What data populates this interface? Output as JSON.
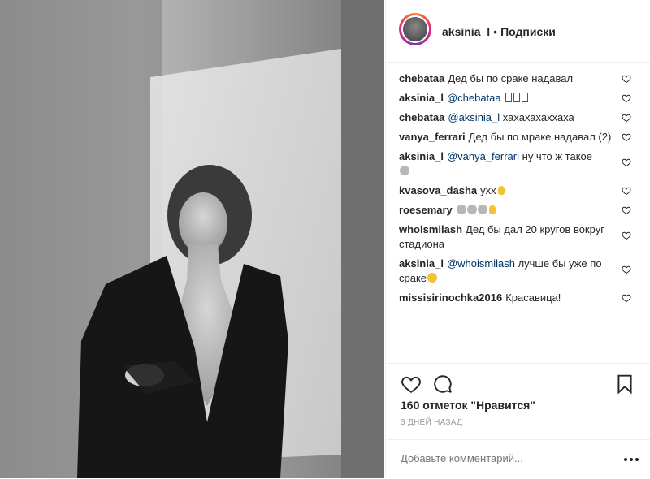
{
  "header": {
    "username": "aksinia_l",
    "separator": "•",
    "follow_label": "Подписки"
  },
  "comments": [
    {
      "user": "chebataa",
      "text": "Дед бы по сраке надавал"
    },
    {
      "user": "aksinia_l",
      "mention": "@chebataa",
      "text": "",
      "glyphs": "boxes"
    },
    {
      "user": "chebataa",
      "mention": "@aksinia_l",
      "text": "хахахахаххаха"
    },
    {
      "user": "vanya_ferrari",
      "text": "Дед бы по мраке надавал (2)"
    },
    {
      "user": "aksinia_l",
      "mention": "@vanya_ferrari",
      "text": "ну что ж такое",
      "emoji": "face"
    },
    {
      "user": "kvasova_dasha",
      "text": "ухх",
      "emoji": "hand"
    },
    {
      "user": "roesemary",
      "text": "",
      "emoji": "cats-hand"
    },
    {
      "user": "whoismilash",
      "text": "Дед бы дал 20 кругов вокруг стадиона"
    },
    {
      "user": "aksinia_l",
      "mention": "@whoismilash",
      "text": "лучше бы уже по сраке",
      "emoji": "lol"
    },
    {
      "user": "missisirinochka2016",
      "text": "Красавица!"
    }
  ],
  "likes_text": "160 отметок \"Нравится\"",
  "time_ago": "3 дней назад",
  "comment_placeholder": "Добавьте комментарий...",
  "icons": {
    "like": "heart-icon",
    "comment": "comment-bubble-icon",
    "save": "bookmark-icon",
    "more": "more-dots-icon",
    "comment_like": "heart-outline-small-icon"
  }
}
